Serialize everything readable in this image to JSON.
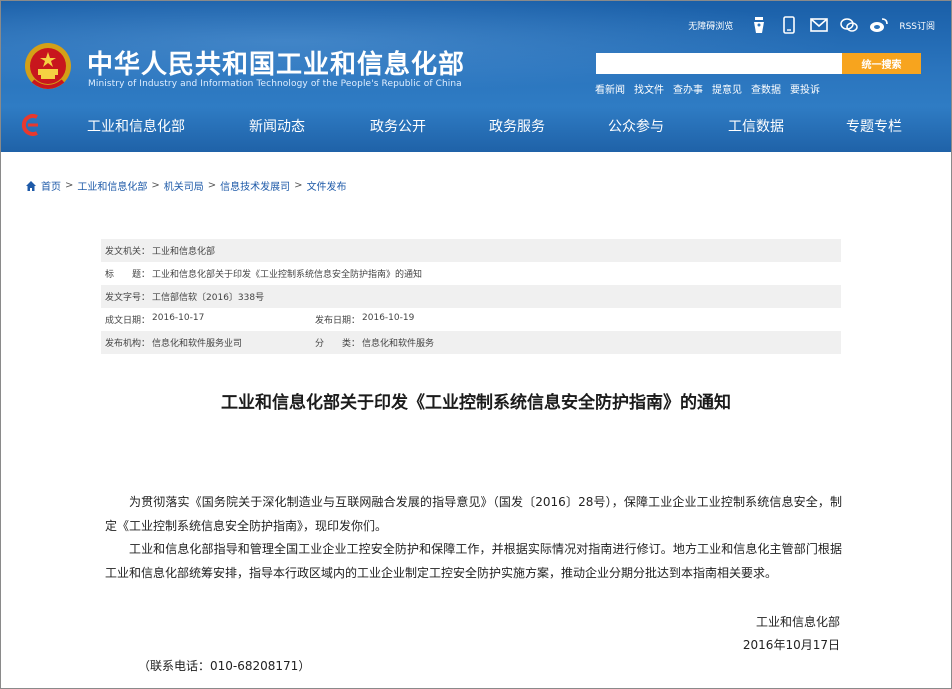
{
  "header": {
    "site_title": "中华人民共和国工业和信息化部",
    "site_subtitle": "Ministry of Industry and Information Technology of the People's Republic of China",
    "accessible_label": "无障碍浏览",
    "rss_label": "RSS订阅",
    "search_placeholder": "",
    "search_button": "统一搜索",
    "quick_links": [
      "看新闻",
      "找文件",
      "查办事",
      "提意见",
      "查数据",
      "要投诉"
    ]
  },
  "nav": {
    "items": [
      "工业和信息化部",
      "新闻动态",
      "政务公开",
      "政务服务",
      "公众参与",
      "工信数据",
      "专题专栏"
    ]
  },
  "breadcrumb": [
    "首页",
    "工业和信息化部",
    "机关司局",
    "信息技术发展司",
    "文件发布"
  ],
  "meta": {
    "issuer_label": "发文机关：",
    "issuer": "工业和信息化部",
    "title_label": "标　　题：",
    "title": "工业和信息化部关于印发《工业控制系统信息安全防护指南》的通知",
    "docno_label": "发文字号：",
    "docno": "工信部信软〔2016〕338号",
    "written_label": "成文日期：",
    "written": "2016-10-17",
    "published_label": "发布日期：",
    "published": "2016-10-19",
    "org_label": "发布机构：",
    "org": "信息化和软件服务业司",
    "category_label": "分　　类：",
    "category": "信息化和软件服务"
  },
  "document": {
    "heading": "工业和信息化部关于印发《工业控制系统信息安全防护指南》的通知",
    "paragraph1": "为贯彻落实《国务院关于深化制造业与互联网融合发展的指导意见》（国发〔2016〕28号），保障工业企业工业控制系统信息安全，制定《工业控制系统信息安全防护指南》，现印发你们。",
    "paragraph2": "工业和信息化部指导和管理全国工业企业工控安全防护和保障工作，并根据实际情况对指南进行修订。地方工业和信息化主管部门根据工业和信息化部统筹安排，指导本行政区域内的工业企业制定工控安全防护实施方案，推动企业分期分批达到本指南相关要求。",
    "signature": "工业和信息化部",
    "date": "2016年10月17日",
    "contact": "（联系电话：010-68208171）"
  },
  "colors": {
    "header_blue": "#2a74bd",
    "search_orange": "#f7a41e",
    "link_blue": "#1e5aa8",
    "meta_shade": "#f0f0f0"
  }
}
